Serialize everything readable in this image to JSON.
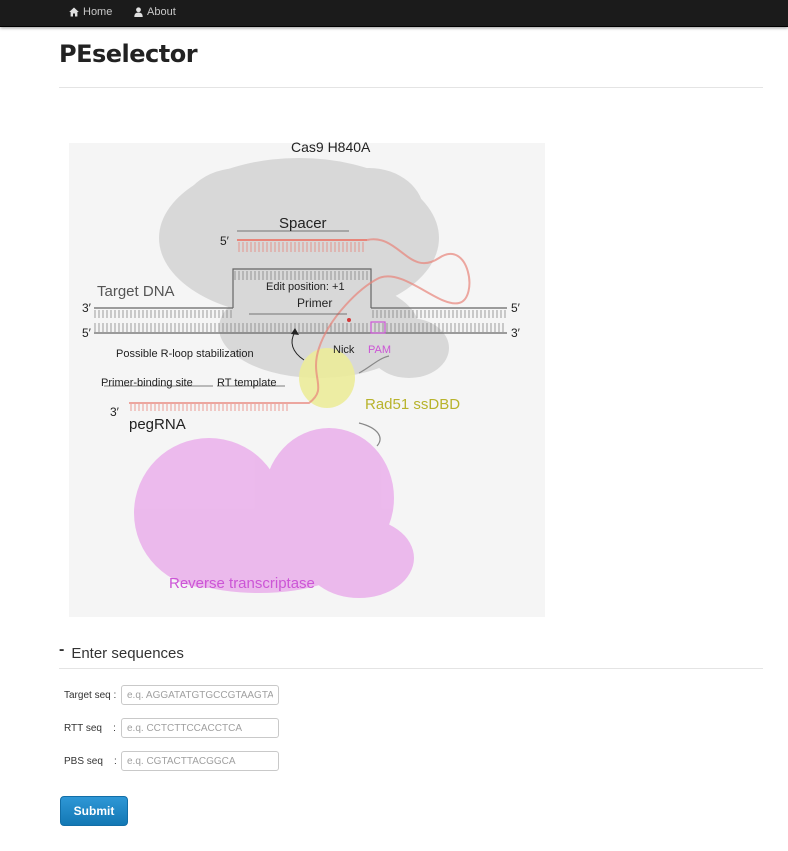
{
  "nav": {
    "home_label": "Home",
    "about_label": "About"
  },
  "page": {
    "title": "PEselector"
  },
  "figure": {
    "cas9_label": "Cas9 H840A",
    "spacer_label": "Spacer",
    "target_dna_label": "Target DNA",
    "edit_position_label": "Edit position: +1",
    "primer_label": "Primer",
    "five_prime": "5′",
    "three_prime": "3′",
    "rloop_label": "Possible R-loop stabilization",
    "nick_label": "Nick",
    "pam_label": "PAM",
    "pbs_label": "Primer-binding site",
    "rt_template_label": "RT template",
    "rad51_label": "Rad51 ssDBD",
    "pegrna_label": "pegRNA",
    "rt_label": "Reverse transcriptase",
    "colors": {
      "spacer": "#e8857a",
      "rad51": "#c8c23a",
      "pam": "#cc55d6",
      "rt_protein": "#e8a6ea",
      "cas9_protein": "#d9d9d9"
    }
  },
  "form": {
    "section_title": "Enter sequences",
    "toggle_symbol": "-",
    "target": {
      "label": "Target seq :",
      "placeholder": "e.q. AGGATATGTGCCGTAAGTAC"
    },
    "rtt": {
      "label": "RTT seq    :",
      "placeholder": "e.q. CCTCTTCCACCTCA"
    },
    "pbs": {
      "label": "PBS seq    :",
      "placeholder": "e.q. CGTACTTACGGCA"
    },
    "submit_label": "Submit"
  }
}
